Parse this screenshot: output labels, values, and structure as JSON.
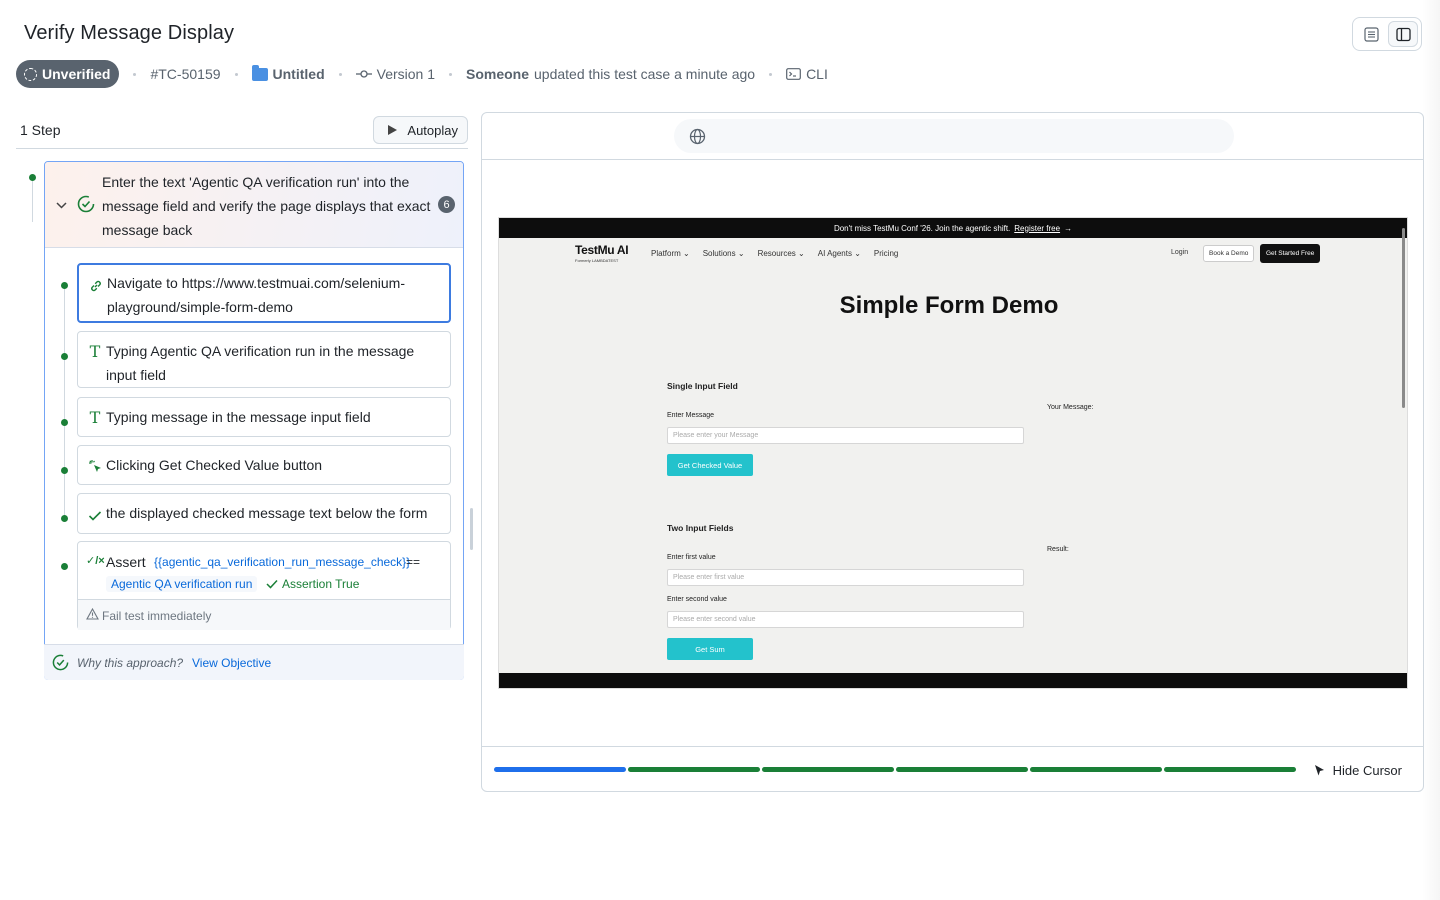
{
  "header": {
    "title": "Verify Message Display",
    "status_badge": "Unverified",
    "test_id": "#TC-50159",
    "folder": "Untitled",
    "version": "Version 1",
    "updated_by": "Someone",
    "updated_text": "updated this test case a minute ago",
    "cli": "CLI"
  },
  "steps_panel": {
    "count_label": "1 Step",
    "autoplay_label": "Autoplay",
    "step": {
      "text": "Enter the text 'Agentic QA verification run' into the message field and verify the page displays that exact message back",
      "sub_count": "6"
    },
    "substeps": [
      {
        "icon": "link-icon",
        "text": "Navigate to https://www.testmuai.com/selenium-playground/simple-form-demo"
      },
      {
        "icon": "text-type-icon",
        "text": "Typing Agentic QA verification run in the message input field"
      },
      {
        "icon": "text-type-icon",
        "text": "Typing message in the message input field"
      },
      {
        "icon": "click-sparkle-icon",
        "text": "Clicking Get Checked Value button"
      },
      {
        "icon": "check-icon",
        "text": "the displayed checked message text below the form"
      }
    ],
    "assert": {
      "icon_text": "✓/×",
      "label": "Assert",
      "variable": "{{agentic_qa_verification_run_message_check}}",
      "operator": "==",
      "value": "Agentic QA verification run",
      "result": "Assertion True",
      "fail_text": "Fail test immediately"
    },
    "why": {
      "question": "Why this approach?",
      "link": "View Objective"
    }
  },
  "preview": {
    "site": {
      "banner": "Don't miss TestMu Conf '26. Join the agentic shift.",
      "banner_link": "Register free",
      "logo": "TestMu AI",
      "logo_sub": "Formerly LAMBDATEST",
      "menu": [
        "Platform ⌄",
        "Solutions ⌄",
        "Resources ⌄",
        "AI Agents ⌄",
        "Pricing"
      ],
      "login": "Login",
      "demo_btn": "Book a Demo",
      "start_btn": "Get Started Free",
      "title": "Simple Form Demo",
      "single_section": "Single Input Field",
      "enter_message_label": "Enter Message",
      "enter_message_placeholder": "Please enter your Message",
      "checked_btn": "Get Checked Value",
      "your_message_label": "Your Message:",
      "two_section": "Two Input Fields",
      "first_label": "Enter first value",
      "first_placeholder": "Please enter first value",
      "second_label": "Enter second value",
      "second_placeholder": "Please enter second value",
      "sum_btn": "Get Sum",
      "result_label": "Result:"
    },
    "progress": [
      {
        "state": "current",
        "color": "#1f6feb"
      },
      {
        "state": "done",
        "color": "#1a7f37"
      },
      {
        "state": "done",
        "color": "#1a7f37"
      },
      {
        "state": "done",
        "color": "#1a7f37"
      },
      {
        "state": "done",
        "color": "#1a7f37"
      },
      {
        "state": "done",
        "color": "#1a7f37"
      }
    ],
    "hide_cursor": "Hide Cursor"
  },
  "colors": {
    "accent": "#0969da",
    "success": "#1a7f37",
    "selected_border": "#3d7be0",
    "site_button": "#23c2cc"
  }
}
